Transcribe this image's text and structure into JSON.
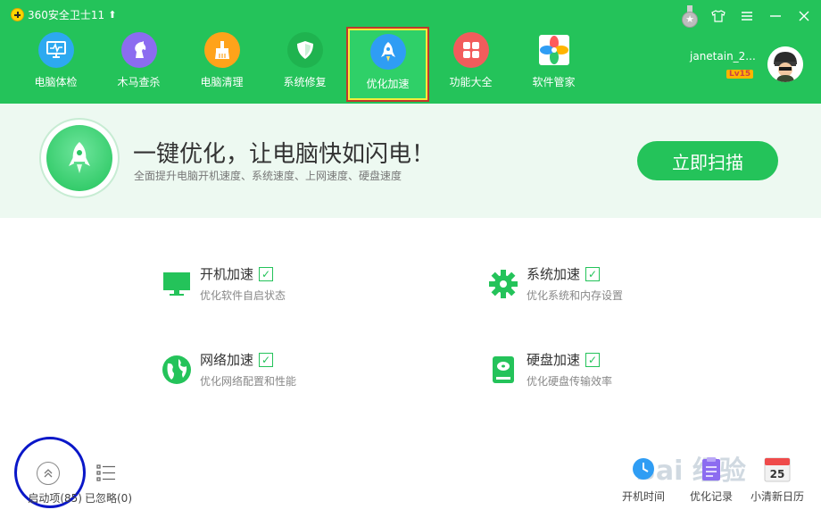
{
  "app": {
    "title": "360安全卫士11"
  },
  "nav": [
    {
      "label": "电脑体检",
      "icon": "monitor-check-icon",
      "color": "#2da9f0"
    },
    {
      "label": "木马查杀",
      "icon": "horse-icon",
      "color": "#8c6cf0"
    },
    {
      "label": "电脑清理",
      "icon": "broom-icon",
      "color": "#ffa31a"
    },
    {
      "label": "系统修复",
      "icon": "shield-icon",
      "color": "#1fb34f"
    },
    {
      "label": "优化加速",
      "icon": "rocket-icon",
      "color": "#2f9df4"
    },
    {
      "label": "功能大全",
      "icon": "grid-icon",
      "color": "#f25c5c"
    },
    {
      "label": "软件管家",
      "icon": "flower-icon",
      "color": "#ffffff"
    }
  ],
  "user": {
    "name": "janetain_2...",
    "level": "Lv15"
  },
  "banner": {
    "title": "一键优化，让电脑快如闪电！",
    "subtitle": "全面提升电脑开机速度、系统速度、上网速度、硬盘速度",
    "scan_button": "立即扫描"
  },
  "features": [
    {
      "title": "开机加速",
      "desc": "优化软件自启状态",
      "icon": "monitor-icon"
    },
    {
      "title": "系统加速",
      "desc": "优化系统和内存设置",
      "icon": "gear-icon"
    },
    {
      "title": "网络加速",
      "desc": "优化网络配置和性能",
      "icon": "globe-icon"
    },
    {
      "title": "硬盘加速",
      "desc": "优化硬盘传输效率",
      "icon": "harddisk-icon"
    }
  ],
  "bottom": {
    "startup_label": "启动项(85)",
    "ignored_label": "已忽略(0)",
    "tools": [
      {
        "label": "开机时间",
        "icon": "clock-icon"
      },
      {
        "label": "优化记录",
        "icon": "record-icon"
      },
      {
        "label": "小清新日历",
        "icon": "calendar-icon",
        "day": "25"
      }
    ]
  },
  "watermark": "Bai 经验",
  "colors": {
    "brand_green": "#24c35a",
    "highlight_border": "#c0392b",
    "annotation_blue": "#0a17c8"
  }
}
